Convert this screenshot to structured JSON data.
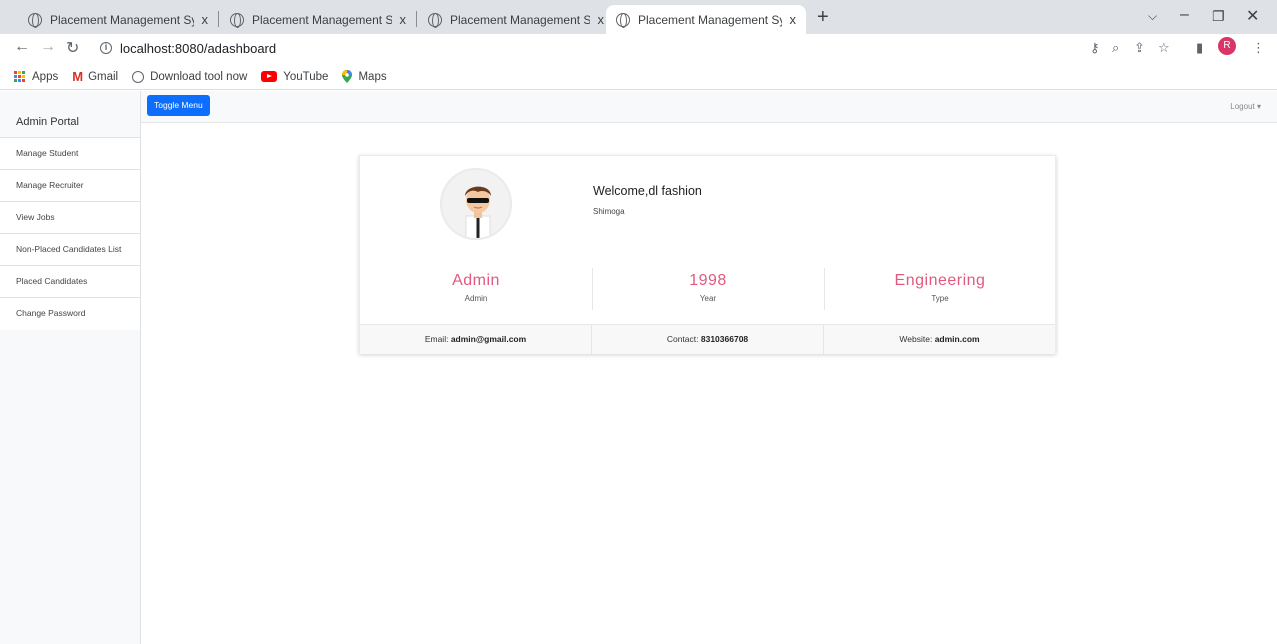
{
  "browser": {
    "tabs": [
      {
        "title": "Placement Management System",
        "close": "x"
      },
      {
        "title": "Placement Management System",
        "close": "x"
      },
      {
        "title": "Placement Management System",
        "close": "x"
      },
      {
        "title": "Placement Management System",
        "close": "x"
      }
    ],
    "new_tab": "+",
    "url": "localhost:8080/adashboard",
    "profile_initial": "R",
    "bookmarks": [
      {
        "label": "Apps",
        "icon": "apps-grid-icon"
      },
      {
        "label": "Gmail",
        "icon": "gmail-icon"
      },
      {
        "label": "Download tool now",
        "icon": "globe-icon"
      },
      {
        "label": "YouTube",
        "icon": "youtube-icon"
      },
      {
        "label": "Maps",
        "icon": "maps-icon"
      }
    ]
  },
  "sidebar": {
    "title": "Admin Portal",
    "items": [
      {
        "label": "Manage Student"
      },
      {
        "label": "Manage Recruiter"
      },
      {
        "label": "View Jobs"
      },
      {
        "label": "Non-Placed Candidates List"
      },
      {
        "label": "Placed Candidates"
      },
      {
        "label": "Change Password"
      }
    ]
  },
  "topnav": {
    "toggle_label": "Toggle Menu",
    "logout_label": "Logout ▾"
  },
  "profile": {
    "welcome": "Welcome,dl fashion",
    "city": "Shimoga",
    "stats": [
      {
        "value": "Admin",
        "label": "Admin"
      },
      {
        "value": "1998",
        "label": "Year"
      },
      {
        "value": "Engineering",
        "label": "Type"
      }
    ],
    "contact": {
      "email_label": "Email: ",
      "email": "admin@gmail.com",
      "contact_label": "Contact: ",
      "phone": "8310366708",
      "website_label": "Website: ",
      "website": "admin.com"
    }
  },
  "colors": {
    "accent": "#e2597f",
    "primary_button": "#0d6efd",
    "profile_badge": "#d93668"
  }
}
